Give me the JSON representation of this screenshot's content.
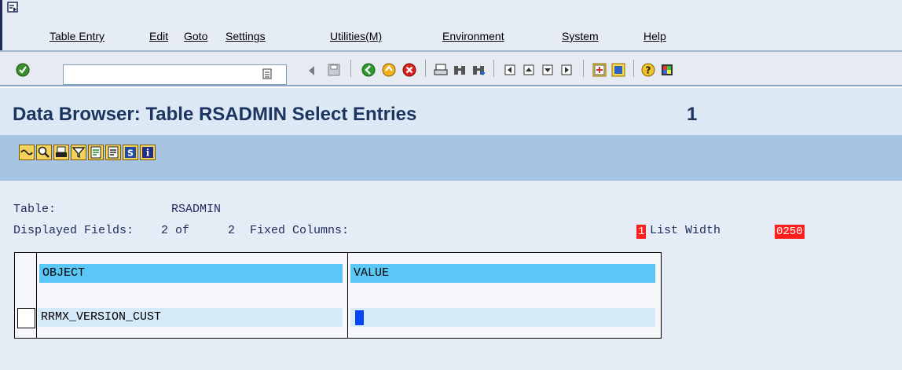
{
  "menu": {
    "items": [
      "Table Entry",
      "Edit",
      "Goto",
      "Settings",
      "Utilities(M)",
      "Environment",
      "System",
      "Help"
    ]
  },
  "toolbar": {
    "command_field_value": "",
    "icons": [
      "enter-icon",
      "command-dropdown-icon",
      "back-arrow-icon",
      "save-icon",
      "back-icon",
      "exit-icon",
      "cancel-icon",
      "print-icon",
      "find-icon",
      "find-next-icon",
      "first-page-icon",
      "previous-page-icon",
      "next-page-icon",
      "last-page-icon",
      "create-session-icon",
      "shortcut-icon",
      "help-icon",
      "layout-menu-icon"
    ]
  },
  "title": {
    "text": "Data Browser: Table RSADMIN Select Entries",
    "count": "1"
  },
  "app_toolbar": {
    "icons": [
      "display-icon",
      "details-icon",
      "print-list-icon",
      "filter-icon",
      "spreadsheet-icon",
      "export-icon",
      "refresh-icon",
      "info-icon"
    ]
  },
  "info": {
    "table_label": "Table:",
    "table_value": "RSADMIN",
    "displayed_fields_label": "Displayed Fields:",
    "displayed_fields_value": "2 of",
    "displayed_fields_total": "2",
    "fixed_columns_label": "Fixed Columns:",
    "fixed_columns_value": "1",
    "list_width_label": "List Width",
    "list_width_value": "0250"
  },
  "table": {
    "columns": [
      "OBJECT",
      "VALUE"
    ],
    "rows": [
      {
        "object": "RRMX_VERSION_CUST",
        "value": ""
      }
    ]
  },
  "colors": {
    "header_cell": "#5ac7f7",
    "row_cell": "#d6ebf9",
    "title_text": "#1b3560",
    "highlight_red": "#ff1f1f",
    "cursor_blue": "#0645f0"
  }
}
